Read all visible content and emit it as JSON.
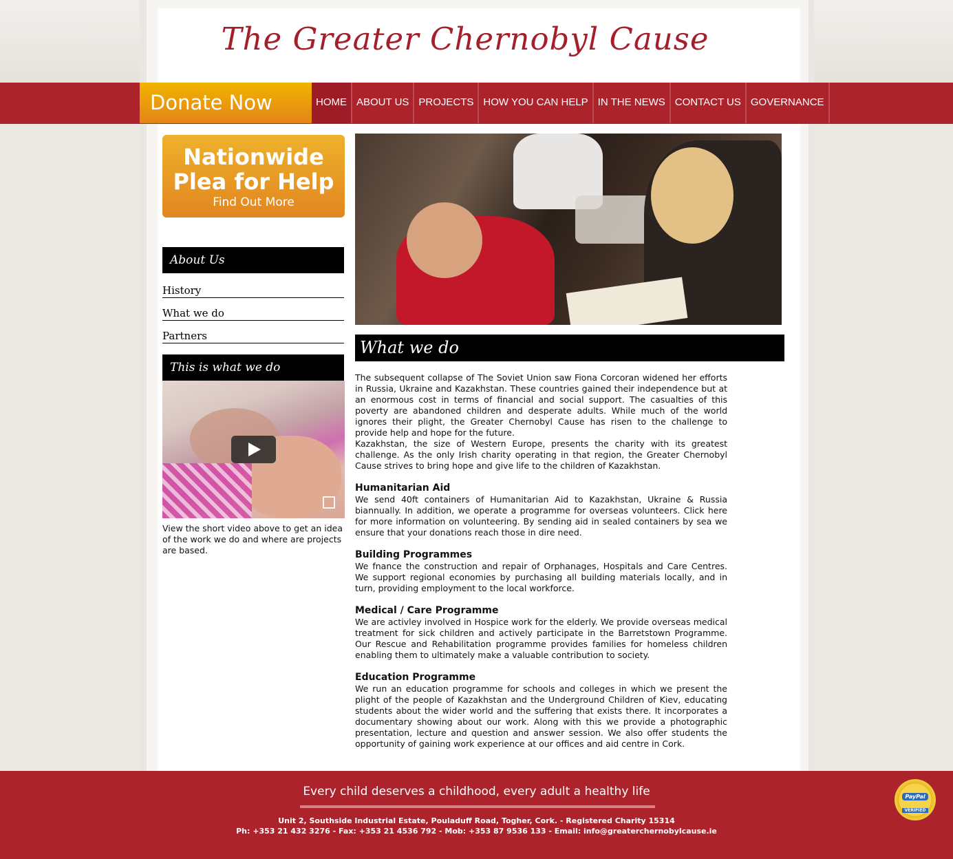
{
  "header": {
    "title": "The Greater Chernobyl Cause"
  },
  "nav": {
    "donate_label": "Donate Now",
    "items": [
      "HOME",
      "ABOUT US",
      "PROJECTS",
      "HOW YOU CAN HELP",
      "IN THE NEWS",
      "CONTACT US",
      "GOVERNANCE"
    ],
    "active": "HOME"
  },
  "sidebar": {
    "promo": {
      "title_line1": "Nationwide",
      "title_line2": "Plea for Help",
      "sub": "Find Out More"
    },
    "about_heading": "About Us",
    "links": [
      "History",
      "What we do",
      "Partners"
    ],
    "video_heading": "This is what we do",
    "video_caption": "View the short video above to get an idea of the work we do and where are projects are based."
  },
  "main": {
    "heading": "What we do",
    "intro_1": "The subsequent collapse of The Soviet Union saw Fiona Corcoran widened her efforts in Russia, Ukraine and Kazakhstan. These countries gained their independence but at an enormous cost in terms of financial and social support. The casualties of this poverty are abandoned children and desperate adults. While much of the world ignores their plight, the Greater Chernobyl Cause has risen to the challenge to provide help and hope for the future.",
    "intro_2": "Kazakhstan, the size of Western Europe, presents the charity with its greatest challenge. As the only Irish charity operating in that region, the Greater Chernobyl Cause strives to bring hope and give life to the children of Kazakhstan.",
    "sections": [
      {
        "title": "Humanitarian Aid",
        "body": "We send 40ft containers of Humanitarian Aid to Kazakhstan, Ukraine & Russia biannually. In addition, we operate a programme for overseas volunteers. Click here for more information on volunteering. By sending aid in sealed containers by sea we ensure that your donations reach those in dire need."
      },
      {
        "title": "Building Programmes",
        "body": "We fnance the construction and repair of Orphanages, Hospitals and Care Centres. We support regional economies by purchasing all building materials locally, and in turn, providing employment to the local workforce."
      },
      {
        "title": "Medical / Care Programme",
        "body": "We are activley involved in Hospice work for the elderly. We provide overseas medical treatment for sick children and actively participate in the Barretstown Programme. Our Rescue and Rehabilitation programme provides families for homeless children enabling them to ultimately make a valuable contribution to society."
      },
      {
        "title": "Education Programme",
        "body": "We run an education programme for schools and colleges in which we present the plight of the people of Kazakhstan and the Underground Children of Kiev, educating students about the wider world and the suffering that exists there. It incorporates a documentary showing about our work. Along with this we provide a photographic presentation, lecture and question and answer session. We also offer students the opportunity of gaining work experience at our offices and aid centre in Cork."
      }
    ]
  },
  "footer": {
    "tagline": "Every child deserves a childhood, every adult a healthy life",
    "address": "Unit 2, Southside Industrial Estate, Pouladuff Road, Togher, Cork. - Registered Charity 15314",
    "contact": "Ph: +353 21 432 3276 - Fax: +353 21 4536 792 - Mob: +353 87 9536 133 - Email: info@greaterchernobylcause.ie",
    "badge_text": "PayPal",
    "badge_sub": "VERIFIED"
  },
  "colors": {
    "brand_red": "#ad232c",
    "title_red": "#a51f2b",
    "donate_orange": "#e48416"
  }
}
